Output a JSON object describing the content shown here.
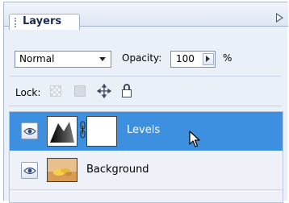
{
  "panel": {
    "tab_label": "Layers"
  },
  "blend": {
    "mode": "Normal",
    "opacity_label": "Opacity:",
    "opacity_value": "100",
    "percent_sign": "%"
  },
  "lock": {
    "label": "Lock:",
    "icons": [
      "lock-transparency-icon",
      "lock-image-icon",
      "lock-position-icon",
      "lock-all-icon"
    ]
  },
  "layers": [
    {
      "name": "Levels",
      "selected": true,
      "visible": true,
      "type": "adjustment-levels"
    },
    {
      "name": "Background",
      "selected": false,
      "visible": true,
      "type": "image"
    }
  ],
  "colors": {
    "selection": "#3d8fe0",
    "panel_bg": "#eaf0f8"
  }
}
